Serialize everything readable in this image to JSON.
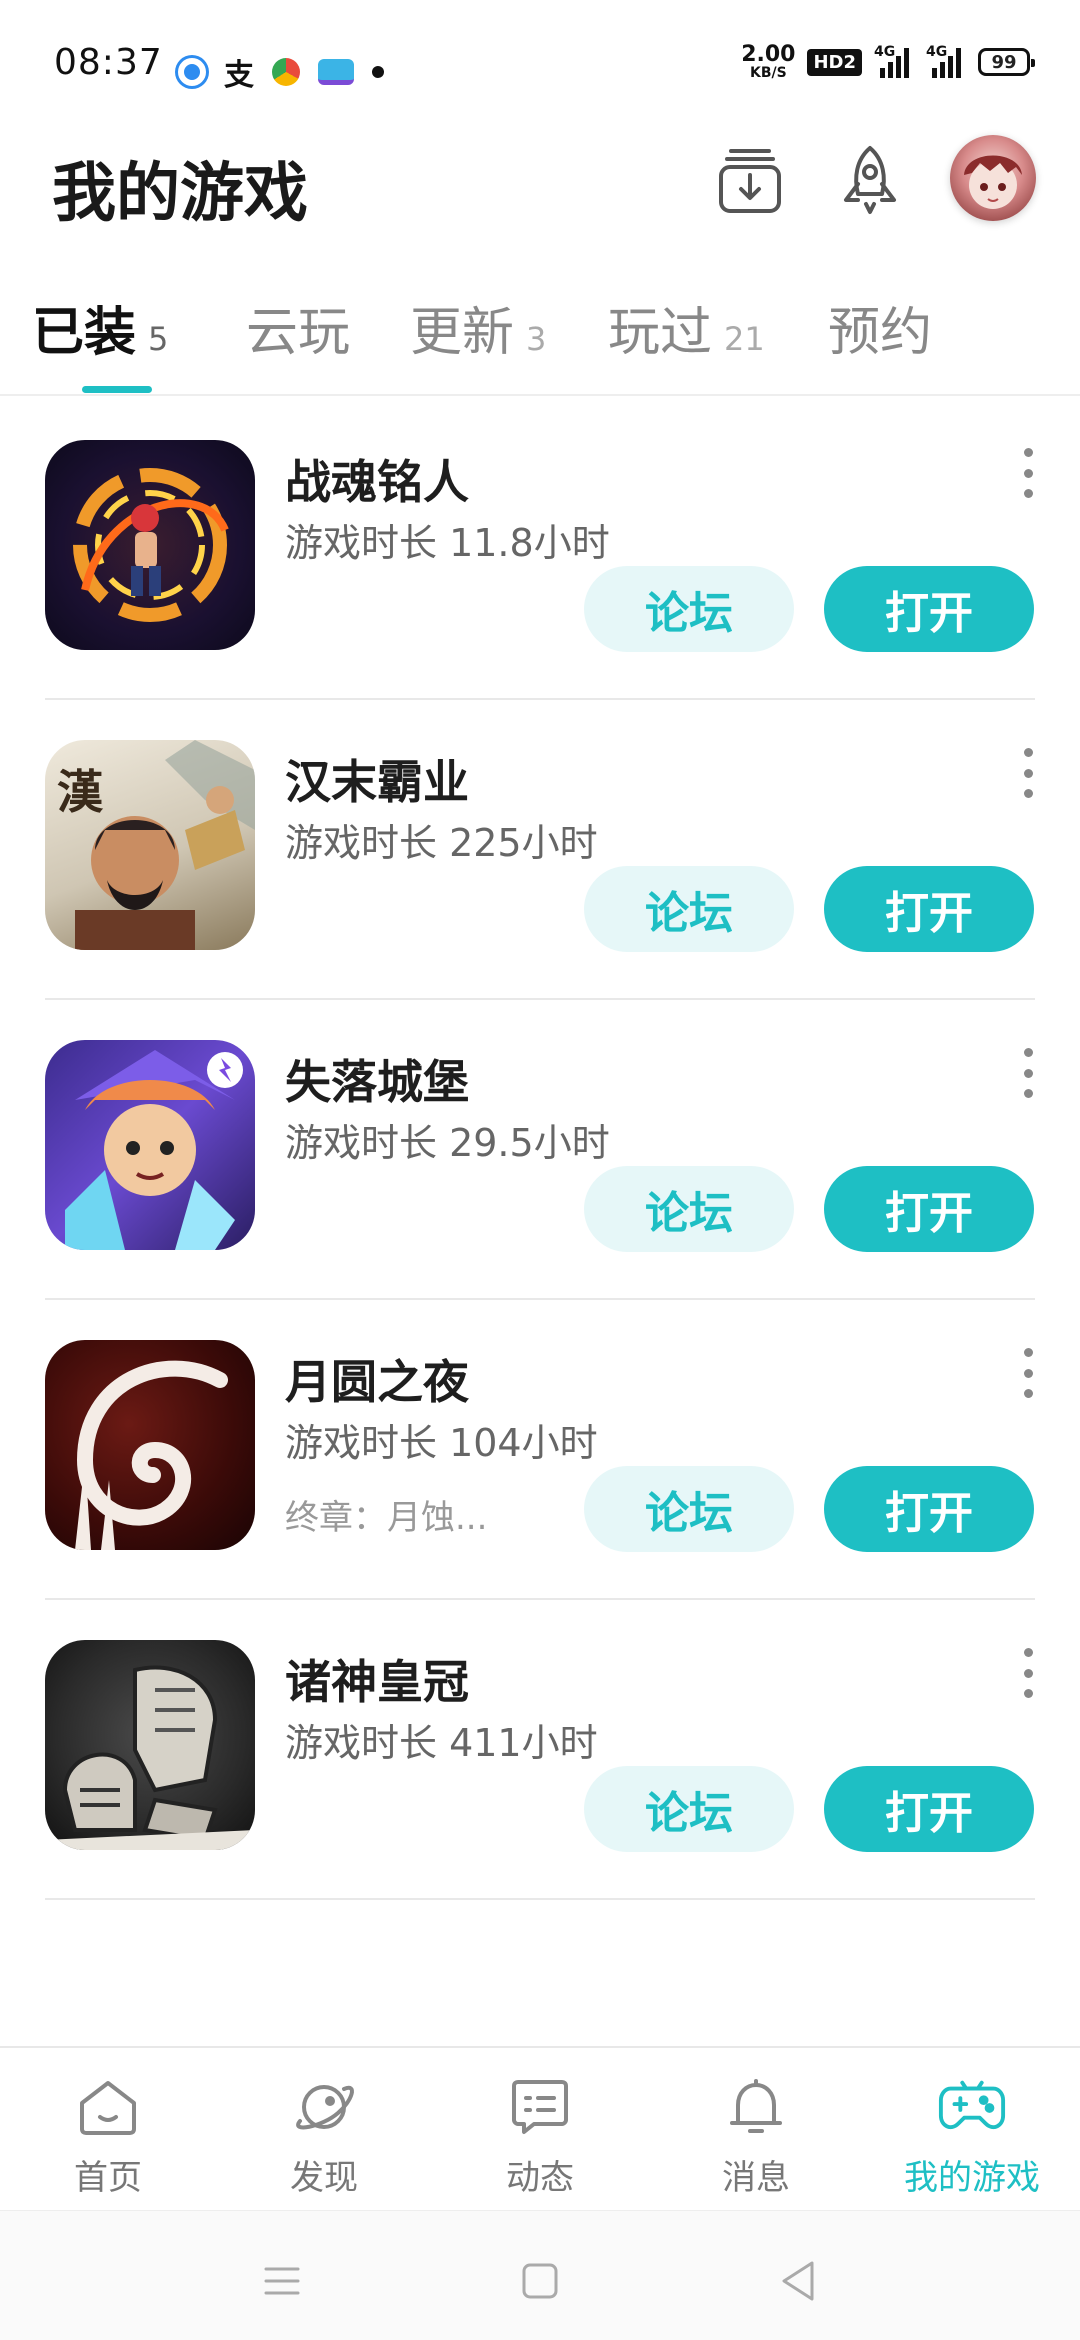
{
  "status_bar": {
    "time": "08:37",
    "net_speed_value": "2.00",
    "net_speed_unit": "KB/S",
    "hd_label": "HD2",
    "signal1_label": "4G",
    "signal2_label": "4G",
    "battery_level": "99"
  },
  "header": {
    "title": "我的游戏",
    "icons": [
      "download-manager-icon",
      "rocket-icon",
      "avatar"
    ]
  },
  "tabs": [
    {
      "label": "已装",
      "count": "5",
      "active": true
    },
    {
      "label": "云玩",
      "count": "",
      "active": false
    },
    {
      "label": "更新",
      "count": "3",
      "active": false
    },
    {
      "label": "玩过",
      "count": "21",
      "active": false
    },
    {
      "label": "预约",
      "count": "",
      "active": false
    }
  ],
  "games": [
    {
      "name": "战魂铭人",
      "playtime": "游戏时长 11.8小时",
      "subtitle": "",
      "forum_label": "论坛",
      "open_label": "打开"
    },
    {
      "name": "汉末霸业",
      "playtime": "游戏时长 225小时",
      "subtitle": "",
      "forum_label": "论坛",
      "open_label": "打开",
      "icon_text": "漢"
    },
    {
      "name": "失落城堡",
      "playtime": "游戏时长 29.5小时",
      "subtitle": "",
      "forum_label": "论坛",
      "open_label": "打开"
    },
    {
      "name": "月圆之夜",
      "playtime": "游戏时长 104小时",
      "subtitle": "终章：月蚀...",
      "forum_label": "论坛",
      "open_label": "打开"
    },
    {
      "name": "诸神皇冠",
      "playtime": "游戏时长 411小时",
      "subtitle": "",
      "forum_label": "论坛",
      "open_label": "打开"
    }
  ],
  "bottom_nav": [
    {
      "label": "首页",
      "icon": "home-icon",
      "active": false
    },
    {
      "label": "发现",
      "icon": "planet-icon",
      "active": false
    },
    {
      "label": "动态",
      "icon": "message-card-icon",
      "active": false
    },
    {
      "label": "消息",
      "icon": "bell-icon",
      "active": false
    },
    {
      "label": "我的游戏",
      "icon": "gamepad-icon",
      "active": true
    }
  ],
  "colors": {
    "accent": "#1ebfc4",
    "forum_button_bg": "#e6f7f8"
  }
}
